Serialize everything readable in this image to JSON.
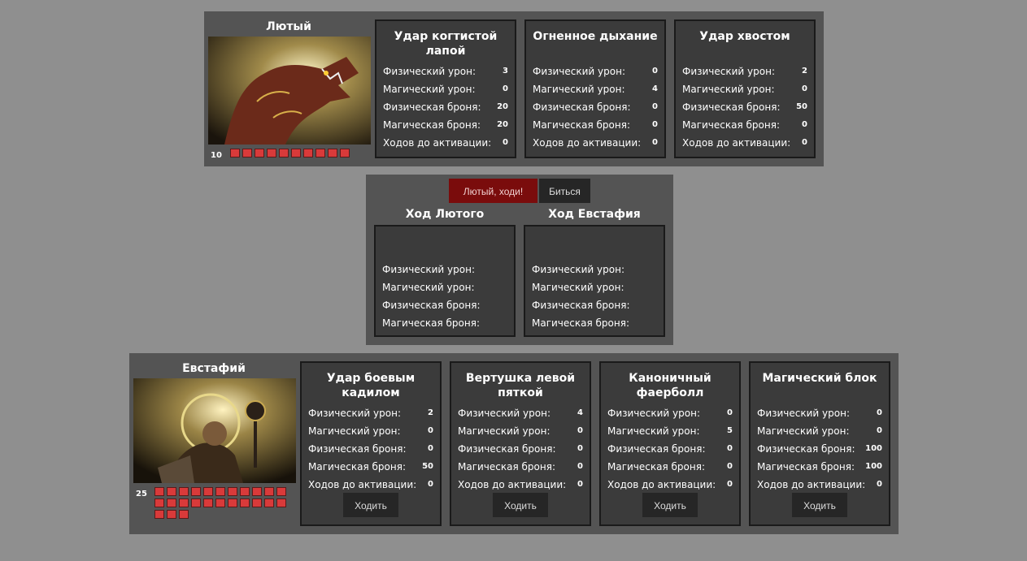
{
  "enemy": {
    "name": "Лютый",
    "hp": "10",
    "hp_cells": 10,
    "abilities": [
      {
        "title": "Удар когтистой лапой",
        "phys_dmg": "3",
        "mag_dmg": "0",
        "phys_armor": "20",
        "mag_armor": "20",
        "cooldown": "0"
      },
      {
        "title": "Огненное дыхание",
        "phys_dmg": "0",
        "mag_dmg": "4",
        "phys_armor": "0",
        "mag_armor": "0",
        "cooldown": "0"
      },
      {
        "title": "Удар хвостом",
        "phys_dmg": "2",
        "mag_dmg": "0",
        "phys_armor": "50",
        "mag_armor": "0",
        "cooldown": "0"
      }
    ]
  },
  "labels": {
    "phys_dmg": "Физический урон:",
    "mag_dmg": "Магический урон:",
    "phys_armor": "Физическая броня:",
    "mag_armor": "Магическая броня:",
    "cooldown": "Ходов до активации:",
    "walk": "Ходить"
  },
  "battle": {
    "turn_button": "Лютый, ходи!",
    "fight_button": "Биться",
    "enemy_turn_title": "Ход Лютого",
    "hero_turn_title": "Ход Евстафия"
  },
  "hero": {
    "name": "Евстафий",
    "hp": "25",
    "hp_cells": 25,
    "abilities": [
      {
        "title": "Удар боевым кадилом",
        "phys_dmg": "2",
        "mag_dmg": "0",
        "phys_armor": "0",
        "mag_armor": "50",
        "cooldown": "0"
      },
      {
        "title": "Вертушка левой пяткой",
        "phys_dmg": "4",
        "mag_dmg": "0",
        "phys_armor": "0",
        "mag_armor": "0",
        "cooldown": "0"
      },
      {
        "title": "Каноничный фаерболл",
        "phys_dmg": "0",
        "mag_dmg": "5",
        "phys_armor": "0",
        "mag_armor": "0",
        "cooldown": "0"
      },
      {
        "title": "Магический блок",
        "phys_dmg": "0",
        "mag_dmg": "0",
        "phys_armor": "100",
        "mag_armor": "100",
        "cooldown": "0"
      }
    ]
  },
  "colors": {
    "background": "#8f8f8f",
    "panel": "#545454",
    "card": "#3b3b3b",
    "hp": "#d93a3a",
    "turn_button": "#7a0c0c"
  }
}
